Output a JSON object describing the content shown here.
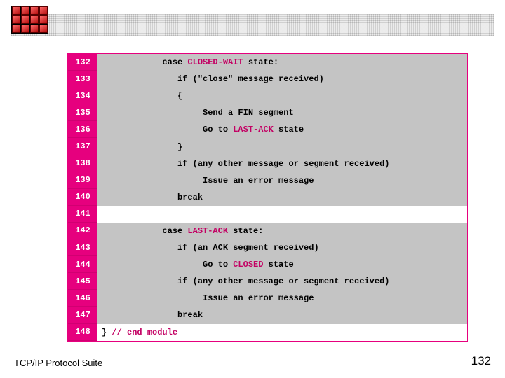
{
  "footer": {
    "title": "TCP/IP Protocol Suite",
    "page": "132"
  },
  "colors": {
    "accent_pink": "#e6007e",
    "state_pink": "#c30063",
    "grey_row": "#c4c4c4"
  },
  "code": {
    "rows": [
      {
        "num": "132",
        "bg": "grey",
        "segments": [
          {
            "t": "            case ",
            "c": "black"
          },
          {
            "t": "CLOSED-WAIT",
            "c": "state"
          },
          {
            "t": " state:",
            "c": "black"
          }
        ]
      },
      {
        "num": "133",
        "bg": "grey",
        "segments": [
          {
            "t": "               if (\"close\" message received)",
            "c": "black"
          }
        ]
      },
      {
        "num": "134",
        "bg": "grey",
        "segments": [
          {
            "t": "               {",
            "c": "black"
          }
        ]
      },
      {
        "num": "135",
        "bg": "grey",
        "segments": [
          {
            "t": "                    Send a FIN segment",
            "c": "black"
          }
        ]
      },
      {
        "num": "136",
        "bg": "grey",
        "segments": [
          {
            "t": "                    Go to ",
            "c": "black"
          },
          {
            "t": "LAST-ACK",
            "c": "state"
          },
          {
            "t": " state",
            "c": "black"
          }
        ]
      },
      {
        "num": "137",
        "bg": "grey",
        "segments": [
          {
            "t": "               }",
            "c": "black"
          }
        ]
      },
      {
        "num": "138",
        "bg": "grey",
        "segments": [
          {
            "t": "               if (any other message or segment received)",
            "c": "black"
          }
        ]
      },
      {
        "num": "139",
        "bg": "grey",
        "segments": [
          {
            "t": "                    Issue an error message",
            "c": "black"
          }
        ]
      },
      {
        "num": "140",
        "bg": "grey",
        "segments": [
          {
            "t": "               break",
            "c": "black"
          }
        ]
      },
      {
        "num": "141",
        "bg": "white",
        "segments": [
          {
            "t": " ",
            "c": "black"
          }
        ]
      },
      {
        "num": "142",
        "bg": "grey",
        "segments": [
          {
            "t": "            case ",
            "c": "black"
          },
          {
            "t": "LAST-ACK",
            "c": "state"
          },
          {
            "t": " state:",
            "c": "black"
          }
        ]
      },
      {
        "num": "143",
        "bg": "grey",
        "segments": [
          {
            "t": "               if (an ACK segment received)",
            "c": "black"
          }
        ]
      },
      {
        "num": "144",
        "bg": "grey",
        "segments": [
          {
            "t": "                    Go to ",
            "c": "black"
          },
          {
            "t": "CLOSED",
            "c": "state"
          },
          {
            "t": " state",
            "c": "black"
          }
        ]
      },
      {
        "num": "145",
        "bg": "grey",
        "segments": [
          {
            "t": "               if (any other message or segment received)",
            "c": "black"
          }
        ]
      },
      {
        "num": "146",
        "bg": "grey",
        "segments": [
          {
            "t": "                    Issue an error message",
            "c": "black"
          }
        ]
      },
      {
        "num": "147",
        "bg": "grey",
        "segments": [
          {
            "t": "               break",
            "c": "black"
          }
        ]
      },
      {
        "num": "148",
        "bg": "white",
        "segments": [
          {
            "t": "} ",
            "c": "black"
          },
          {
            "t": "// end module",
            "c": "state"
          }
        ]
      }
    ]
  }
}
